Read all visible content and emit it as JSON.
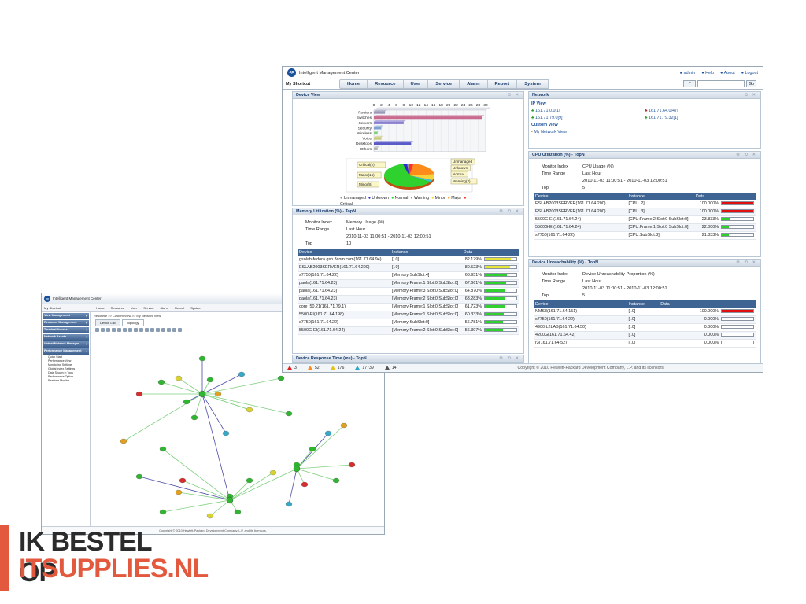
{
  "back": {
    "app_title": "Intelligent Management Center",
    "shortcut": "My Shortcut",
    "menu": [
      "Home",
      "Resource",
      "User",
      "Service",
      "Alarm",
      "Report",
      "System"
    ],
    "sidebar": [
      {
        "title": "View Management",
        "open": false
      },
      {
        "title": "Resource Management",
        "open": false
      },
      {
        "title": "Terminal Access",
        "open": false
      },
      {
        "title": "Network Assets",
        "open": false
      },
      {
        "title": "Virtual Network Manager",
        "open": false
      },
      {
        "title": "Performance Management",
        "open": true,
        "items": [
          "Quick Start",
          "Performance View",
          "Monitoring Settings",
          "Global Index Settings",
          "Data Shown in Tops",
          "Performance Option",
          "Realtime Monitor"
        ]
      }
    ],
    "breadcrumb": "Resource >> Custom View >> My Network View",
    "tabs": [
      "Device List",
      "Topology"
    ],
    "footer": "Copyright © 2010 Hewlett-Packard Development Company, L.P. and its licensors."
  },
  "front": {
    "app_title": "Intelligent Management Center",
    "shortcut": "My Shortcut",
    "menu": [
      "Home",
      "Resource",
      "User",
      "Service",
      "Alarm",
      "Report",
      "System"
    ],
    "user_links": [
      "admin",
      "Help",
      "About",
      "Logout"
    ],
    "go_label": "Go",
    "device_view": {
      "title": "Device View",
      "chart_data": {
        "type": "bar",
        "orientation": "horizontal",
        "categories": [
          "Routers",
          "Switches",
          "Servers",
          "Security",
          "Wireless",
          "Voice",
          "Desktops",
          "Others"
        ],
        "values": [
          3,
          29,
          8,
          2,
          1,
          2,
          10,
          1
        ],
        "xticks": [
          0,
          2,
          4,
          6,
          8,
          10,
          12,
          14,
          16,
          18,
          20,
          22,
          24,
          26,
          28,
          30
        ],
        "xlim": [
          0,
          30
        ]
      },
      "pie": {
        "slices": [
          {
            "name": "Critical",
            "value": 2,
            "color": "#ff3030"
          },
          {
            "name": "Major",
            "value": 15,
            "color": "#ff8c1a"
          },
          {
            "name": "Minor",
            "value": 6,
            "color": "#f5d33a"
          },
          {
            "name": "Warning",
            "value": 2,
            "color": "#36c6d6"
          },
          {
            "name": "Normal",
            "value": 45,
            "color": "#2fd12f"
          },
          {
            "name": "Unknown",
            "value": 2,
            "color": "#2a2acd"
          },
          {
            "name": "Unmanaged",
            "value": 1,
            "color": "#9a9a9a"
          }
        ],
        "callouts": [
          "Critical(2)",
          "Major(15)",
          "Minor(6)",
          "Unmanaged",
          "Unknown",
          "Normal",
          "Warning(2)"
        ]
      },
      "legend": [
        "Unmanaged",
        "Unknown",
        "Normal",
        "Warning",
        "Minor",
        "Major",
        "Critical"
      ]
    },
    "memory": {
      "title": "Memory Utilization (%) - TopN",
      "monitor_index_label": "Monitor Index",
      "monitor_index": "Memory Usage (%)",
      "time_range_label": "Time Range",
      "time_range": "Last Hour",
      "time_span": "2010-11-03 11:00:51 - 2010-11-03 12:00:51",
      "top_label": "Top",
      "top": "10",
      "columns": [
        "Device",
        "Instance",
        "Data"
      ],
      "rows": [
        {
          "device": "gsolab-fedora.gso.3com.com(161.71.64.94)",
          "instance": "[..0]",
          "data": "82.179%",
          "pct": 82.179,
          "color": "#e6e63a"
        },
        {
          "device": "ESLAB2003SERVER(161.71.64.200)",
          "instance": "[..0]",
          "data": "80.523%",
          "pct": 80.523,
          "color": "#e6e63a"
        },
        {
          "device": "s7750(161.71.64.22)",
          "instance": "[Memory:SubSlot:4]",
          "data": "68.951%",
          "pct": 68.951,
          "color": "#2fd12f"
        },
        {
          "device": "paola(161.71.64.23)",
          "instance": "[Memory:Frame:1 Slot:0 SubSlot:0]",
          "data": "67.661%",
          "pct": 67.661,
          "color": "#2fd12f"
        },
        {
          "device": "paola(161.71.64.23)",
          "instance": "[Memory:Frame:3 Slot:0 SubSlot:0]",
          "data": "64.870%",
          "pct": 64.87,
          "color": "#2fd12f"
        },
        {
          "device": "paola(161.71.64.23)",
          "instance": "[Memory:Frame:2 Slot:0 SubSlot:0]",
          "data": "63.283%",
          "pct": 63.283,
          "color": "#2fd12f"
        },
        {
          "device": "core_50.21(161.71.79.1)",
          "instance": "[Memory:Frame:1 Slot:0 SubSlot:0]",
          "data": "61.723%",
          "pct": 61.723,
          "color": "#2fd12f"
        },
        {
          "device": "5500-EI(161.71.64.198)",
          "instance": "[Memory:Frame:1 Slot:0 SubSlot:0]",
          "data": "60.333%",
          "pct": 60.333,
          "color": "#2fd12f"
        },
        {
          "device": "s7750(161.71.64.22)",
          "instance": "[Memory:SubSlot:0]",
          "data": "56.781%",
          "pct": 56.781,
          "color": "#2fd12f"
        },
        {
          "device": "5500G-EI(161.71.64.24)",
          "instance": "[Memory:Frame:2 Slot:0 SubSlot:0]",
          "data": "56.307%",
          "pct": 56.307,
          "color": "#2fd12f"
        }
      ]
    },
    "response": {
      "title": "Device Response Time (ms) - TopN"
    },
    "status": [
      {
        "count": "3",
        "color": "#e02020"
      },
      {
        "count": "52",
        "color": "#ff8c1a"
      },
      {
        "count": "176",
        "color": "#e6c020"
      },
      {
        "count": "17739",
        "color": "#2aa7c9"
      },
      {
        "count": "14",
        "color": "#555555"
      }
    ],
    "network": {
      "title": "Network",
      "ip_view": "IP View",
      "ips": [
        "161.71.0.0[1]",
        "161.71.64.0[47]",
        "161.71.79.0[9]",
        "161.71.79.32[1]"
      ],
      "custom_view": "Custom View",
      "my_view": "My Network View"
    },
    "cpu": {
      "title": "CPU Utilization (%) - TopN",
      "monitor_index_label": "Monitor Index",
      "monitor_index": "CPU Usage (%)",
      "time_range_label": "Time Range",
      "time_range": "Last Hour",
      "time_span": "2010-11-03 11:00:51 - 2010-11-03 12:00:51",
      "top_label": "Top",
      "top": "5",
      "columns": [
        "Device",
        "Instance",
        "Data"
      ],
      "rows": [
        {
          "device": "ESLAB2003SERVER(161.71.64.200)",
          "instance": "[CPU..2]",
          "data": "100.000%",
          "pct": 100,
          "color": "#e01010"
        },
        {
          "device": "ESLAB2003SERVER(161.71.64.200)",
          "instance": "[CPU..3]",
          "data": "100.000%",
          "pct": 100,
          "color": "#e01010"
        },
        {
          "device": "5500G-EI(161.71.64.24)",
          "instance": "[CPU:Frame:2 Slot:0 SubSlot:0]",
          "data": "23.833%",
          "pct": 23.833,
          "color": "#2fd12f"
        },
        {
          "device": "5500G-EI(161.71.64.24)",
          "instance": "[CPU:Frame:1 Slot:0 SubSlot:0]",
          "data": "22.000%",
          "pct": 22,
          "color": "#2fd12f"
        },
        {
          "device": "s7750(161.71.64.22)",
          "instance": "[CPU:SubSlot:3]",
          "data": "21.833%",
          "pct": 21.833,
          "color": "#2fd12f"
        }
      ]
    },
    "unreach": {
      "title": "Device Unreachability (%) - TopN",
      "monitor_index_label": "Monitor Index",
      "monitor_index": "Device Unreachability Proportion (%)",
      "time_range_label": "Time Range",
      "time_range": "Last Hour",
      "time_span": "2010-11-03 11:00:51 - 2010-11-03 12:00:51",
      "top_label": "Top",
      "top": "5",
      "columns": [
        "Device",
        "Instance",
        "Data"
      ],
      "rows": [
        {
          "device": "NMS3(161.71.64.151)",
          "instance": "[..0]",
          "data": "100.000%",
          "pct": 100,
          "color": "#e01010"
        },
        {
          "device": "s7750(161.71.64.22)",
          "instance": "[..0]",
          "data": "0.000%",
          "pct": 0,
          "color": "#2fd12f"
        },
        {
          "device": "4900 L2LAB(161.71.64.50)",
          "instance": "[..0]",
          "data": "0.000%",
          "pct": 0,
          "color": "#2fd12f"
        },
        {
          "device": "4200G(161.71.64.42)",
          "instance": "[..0]",
          "data": "0.000%",
          "pct": 0,
          "color": "#2fd12f"
        },
        {
          "device": "r3(161.71.64.52)",
          "instance": "[..0]",
          "data": "0.000%",
          "pct": 0,
          "color": "#2fd12f"
        }
      ]
    },
    "footer": "Copyright © 2010 Hewlett-Packard Development Company, L.P. and its licensors."
  },
  "brand": {
    "line1": "IK BESTEL OP",
    "line2": "ITSUPPLIES.NL",
    "accent": "#e2593d"
  }
}
